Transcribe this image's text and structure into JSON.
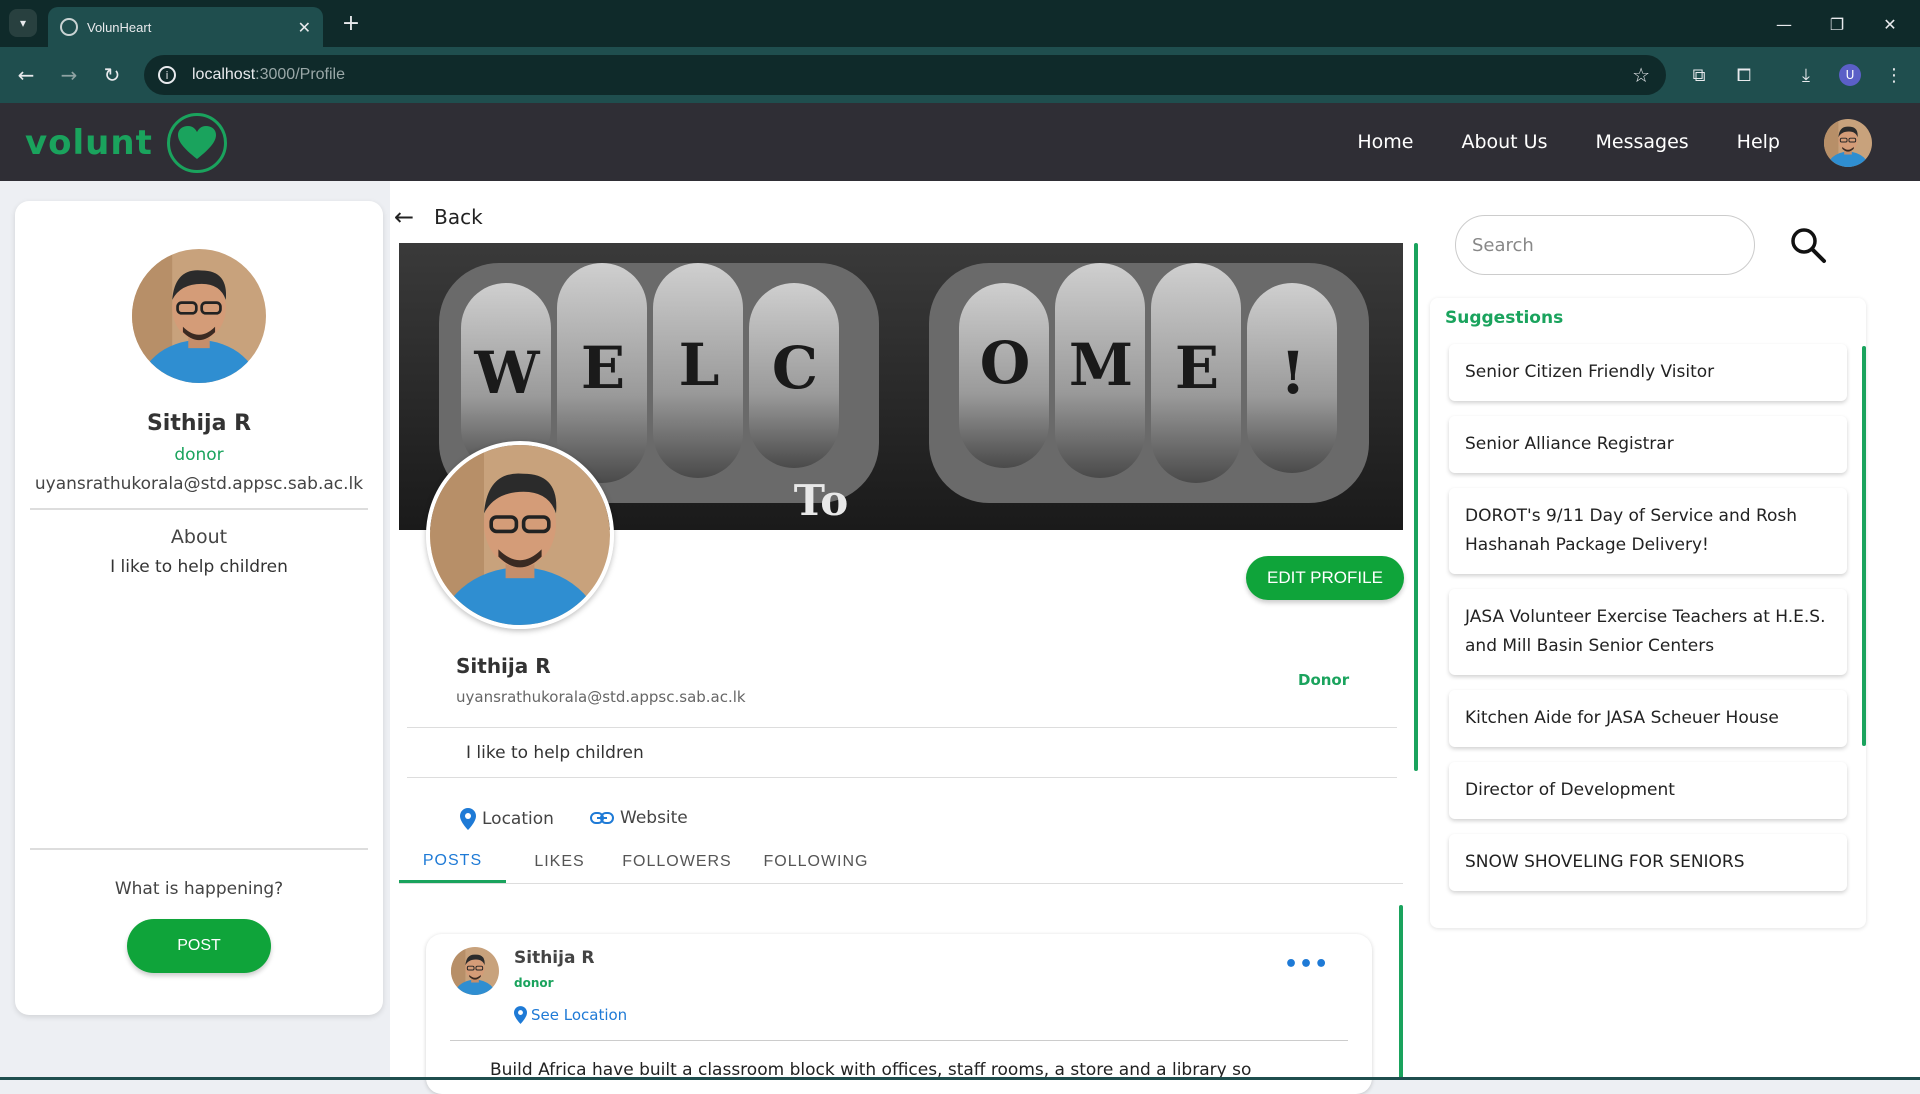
{
  "browser": {
    "tab_title": "VolunHeart",
    "url_host": "localhost",
    "url_path": ":3000/Profile",
    "profile_initial": "U"
  },
  "header": {
    "logo_text": "volunt",
    "nav": [
      "Home",
      "About Us",
      "Messages",
      "Help"
    ]
  },
  "left_card": {
    "name": "Sithija R",
    "role": "donor",
    "email": "uyansrathukorala@std.appsc.sab.ac.lk",
    "about_heading": "About",
    "about_text": "I like to help children",
    "happening_prompt": "What is happening?",
    "post_button": "POST"
  },
  "profile": {
    "back_label": "Back",
    "cover_text": "WELCOME! To",
    "edit_button": "EDIT PROFILE",
    "name": "Sithija R",
    "email": "uyansrathukorala@std.appsc.sab.ac.lk",
    "type": "Donor",
    "bio": "I like to help children",
    "location_label": "Location",
    "website_label": "Website",
    "tabs": [
      "POSTS",
      "LIKES",
      "FOLLOWERS",
      "FOLLOWING"
    ],
    "active_tab": "POSTS"
  },
  "post": {
    "author": "Sithija R",
    "role": "donor",
    "location_link": "See Location",
    "more": "•••",
    "text": "Build Africa have built a classroom block with offices, staff rooms, a store and a library so"
  },
  "right": {
    "search_placeholder": "Search",
    "suggestions_title": "Suggestions",
    "suggestions": [
      "Senior Citizen Friendly Visitor",
      "Senior Alliance Registrar",
      "DOROT's 9/11 Day of Service and Rosh Hashanah Package Delivery!",
      "JASA Volunteer Exercise Teachers at H.E.S. and Mill Basin Senior Centers",
      "Kitchen Aide for JASA Scheuer House",
      "Director of Development",
      "SNOW SHOVELING FOR SENIORS"
    ]
  },
  "colors": {
    "brand_green": "#1aa35d",
    "button_green": "#0fa43a",
    "header_bg": "#2f2e35",
    "link_blue": "#1e7ad6"
  }
}
